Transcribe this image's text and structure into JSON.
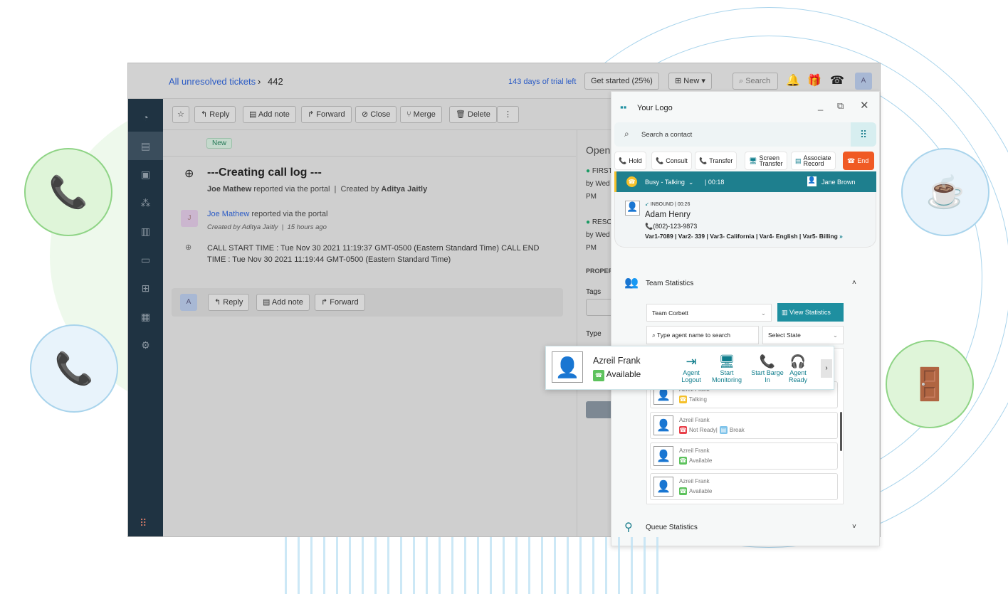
{
  "header": {
    "breadcrumb": "All unresolved tickets",
    "ticket_id": "442",
    "trial": "143 days of trial left",
    "get_started": "Get started (25%)",
    "new": "New",
    "search": "Search",
    "avatar": "A"
  },
  "toolbar": {
    "reply": "Reply",
    "add_note": "Add note",
    "forward": "Forward",
    "close": "Close",
    "merge": "Merge",
    "delete": "Delete"
  },
  "ticket": {
    "status": "New",
    "title": "---Creating call log ---",
    "reporter": "Joe Mathew",
    "via": "reported via the portal",
    "created_by_label": "Created by",
    "created_by": "Aditya Jaitly",
    "note_avatar": "J",
    "note_author": "Joe Mathew",
    "note_via": "reported via the portal",
    "note_created": "Created by  Aditya Jaitly",
    "note_time": "15 hours ago",
    "call_log": "CALL START TIME : Tue Nov 30 2021 11:19:37 GMT-0500 (Eastern Standard Time) CALL END TIME : Tue Nov 30 2021 11:19:44 GMT-0500 (Eastern Standard Time)",
    "reply_avatar": "A"
  },
  "right": {
    "open": "Open",
    "first": "FIRST",
    "by1": "by Wed",
    "pm1": "PM",
    "reso": "RESO",
    "by2": "by Wed",
    "pm2": "PM",
    "properties": "PROPER",
    "tags": "Tags",
    "type": "Type"
  },
  "widget": {
    "logo": "Your Logo",
    "search_placeholder": "Search a contact",
    "hold": "Hold",
    "consult": "Consult",
    "transfer": "Transfer",
    "screen_transfer": "Screen Transfer",
    "associate_record": "Associate Record",
    "end": "End",
    "status": "Busy - Talking",
    "timer": "| 00:18",
    "agent": "Jane Brown",
    "direction": "INBOUND",
    "call_time": "00:26",
    "caller": "Adam Henry",
    "phone": "(802)-123-9873",
    "vars": "Var1-7089 | Var2- 339 | Var3- California | Var4- English | Var5- Billing",
    "team_stats": "Team Statistics",
    "team": "Team Corbett",
    "view_stats": "View Statistics",
    "agent_search": "Type agent name to search",
    "select_state": "Select State",
    "queue_stats": "Queue Statistics",
    "agents": [
      {
        "name": "Azreil Frank",
        "status": "Talking",
        "color": "#f5c02a"
      },
      {
        "name": "Azreil Frank",
        "status": "Not Ready|",
        "extra": "Break",
        "color": "#e8404a"
      },
      {
        "name": "Azreil Frank",
        "status": "Available",
        "color": "#5cc25c"
      },
      {
        "name": "Azreil Frank",
        "status": "Available",
        "color": "#5cc25c"
      }
    ]
  },
  "popup": {
    "name": "Azreil Frank",
    "status": "Available",
    "actions": [
      "Agent Logout",
      "Start Monitoring",
      "Start Barge In",
      "Agent Ready"
    ]
  },
  "colors": {
    "teal": "#1e7f8e",
    "end": "#f05a24",
    "green": "#5cc25c",
    "sidebar": "#1f3342"
  }
}
